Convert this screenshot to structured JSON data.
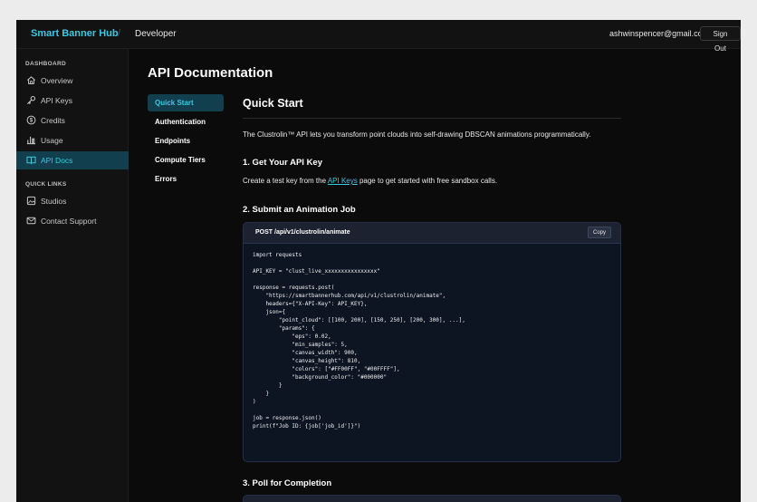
{
  "topbar": {
    "brand": "Smart Banner Hub",
    "separator": "/",
    "crumb": "Developer",
    "user_email": "ashwinspencer@gmail.com",
    "signout_label": "Sign Out"
  },
  "sidebar": {
    "dashboard_label": "DASHBOARD",
    "quick_links_label": "QUICK LINKS",
    "items": [
      {
        "label": "Overview",
        "icon": "home-icon"
      },
      {
        "label": "API Keys",
        "icon": "key-icon"
      },
      {
        "label": "Credits",
        "icon": "dollar-circle-icon"
      },
      {
        "label": "Usage",
        "icon": "bar-chart-icon"
      },
      {
        "label": "API Docs",
        "icon": "book-icon",
        "active": true
      }
    ],
    "quick_links": [
      {
        "label": "Studios",
        "icon": "image-icon"
      },
      {
        "label": "Contact Support",
        "icon": "mail-icon"
      }
    ]
  },
  "main": {
    "title": "API Documentation",
    "subnav": [
      "Quick Start",
      "Authentication",
      "Endpoints",
      "Compute Tiers",
      "Errors"
    ],
    "section_title": "Quick Start",
    "intro": "The Clustrolin™ API lets you transform point clouds into self-drawing DBSCAN animations programmatically.",
    "step1_title": "1. Get Your API Key",
    "step1_before": "Create a test key from the ",
    "step1_link": "API Keys",
    "step1_after": " page to get started with free sandbox calls.",
    "step2_title": "2. Submit an Animation Job",
    "code_endpoint": "POST /api/v1/clustrolin/animate",
    "copy_label": "Copy",
    "code": "import requests\n\nAPI_KEY = \"clust_live_xxxxxxxxxxxxxxxx\"\n\nresponse = requests.post(\n    \"https://smartbannerhub.com/api/v1/clustrolin/animate\",\n    headers={\"X-API-Key\": API_KEY},\n    json={\n        \"point_cloud\": [[100, 200], [150, 250], [200, 300], ...],\n        \"params\": {\n            \"eps\": 0.02,\n            \"min_samples\": 5,\n            \"canvas_width\": 900,\n            \"canvas_height\": 810,\n            \"colors\": [\"#FF00FF\", \"#00FFFF\"],\n            \"background_color\": \"#000000\"\n        }\n    }\n)\n\njob = response.json()\nprint(f\"Job ID: {job['job_id']}\")",
    "step3_title": "3. Poll for Completion"
  },
  "colors": {
    "accent": "#3cc7e4",
    "active_bg": "#123f4d",
    "code_bg": "#0d1422"
  }
}
